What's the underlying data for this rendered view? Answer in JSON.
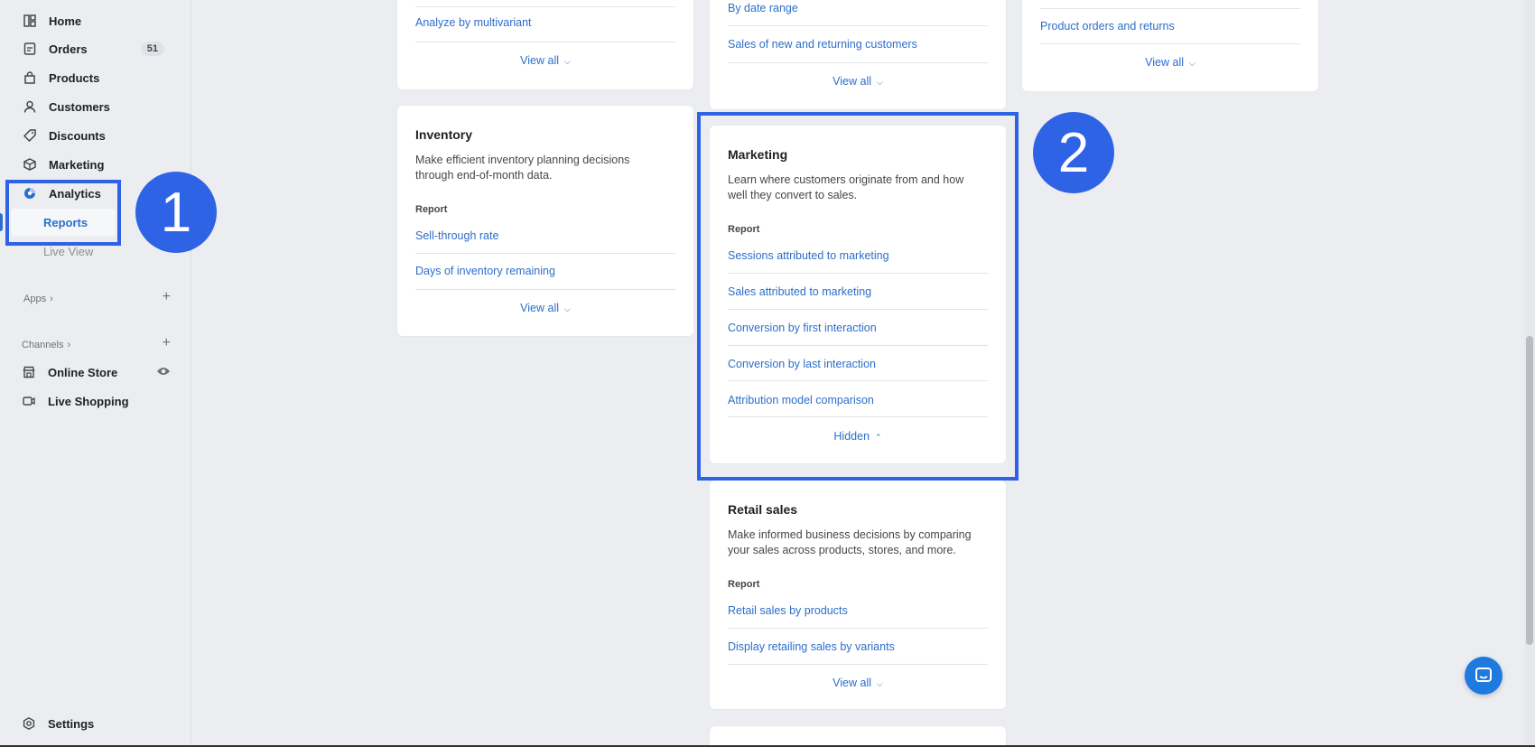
{
  "sidebar": {
    "items": [
      {
        "label": "Home",
        "icon": "home-icon"
      },
      {
        "label": "Orders",
        "icon": "orders-icon",
        "badge": "51"
      },
      {
        "label": "Products",
        "icon": "products-icon"
      },
      {
        "label": "Customers",
        "icon": "customers-icon"
      },
      {
        "label": "Discounts",
        "icon": "discounts-icon"
      },
      {
        "label": "Marketing",
        "icon": "marketing-icon"
      },
      {
        "label": "Analytics",
        "icon": "analytics-icon"
      }
    ],
    "analytics_sub": [
      "Reports",
      "Live View"
    ],
    "apps_label": "Apps",
    "channels_label": "Channels",
    "channels": [
      {
        "label": "Online Store",
        "icon": "store-icon"
      },
      {
        "label": "Live Shopping",
        "icon": "video-icon"
      }
    ],
    "settings_label": "Settings"
  },
  "cards": {
    "top_left": {
      "links": [
        "Analyze by multivariant"
      ],
      "view_all": "View all"
    },
    "top_middle": {
      "links": [
        "By date range",
        "Sales of new and returning customers"
      ],
      "view_all": "View all"
    },
    "top_right": {
      "links": [
        "Product orders and returns"
      ],
      "view_all": "View all"
    },
    "inventory": {
      "title": "Inventory",
      "desc_line1": "Make efficient inventory planning decisions",
      "desc_line2": "through end-of-month data.",
      "report_label": "Report",
      "links": [
        "Sell-through rate",
        "Days of inventory remaining"
      ],
      "view_all": "View all"
    },
    "marketing": {
      "title": "Marketing",
      "desc_line1": "Learn where customers originate from and how",
      "desc_line2": "well they convert to sales.",
      "report_label": "Report",
      "links": [
        "Sessions attributed to marketing",
        "Sales attributed to marketing",
        "Conversion by first interaction",
        "Conversion by last interaction",
        "Attribution model comparison"
      ],
      "toggle": "Hidden"
    },
    "retail": {
      "title": "Retail sales",
      "desc_line1": "Make informed business decisions by comparing",
      "desc_line2": "your sales across products, stores, and more.",
      "report_label": "Report",
      "links": [
        "Retail sales by products",
        "Display retailing sales by variants"
      ],
      "view_all": "View all"
    }
  },
  "annotations": {
    "step1": "1",
    "step2": "2"
  },
  "colors": {
    "accent": "#2f63e6",
    "link": "#2c6ecb"
  }
}
